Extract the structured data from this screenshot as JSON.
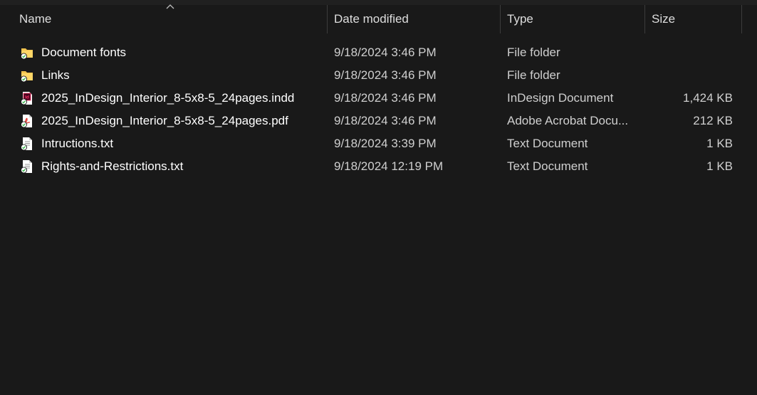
{
  "columns": {
    "name": "Name",
    "date": "Date modified",
    "type": "Type",
    "size": "Size"
  },
  "sort": {
    "column": "name",
    "direction": "ascending",
    "icon": "chevron-up-icon"
  },
  "files": [
    {
      "name": "Document fonts",
      "date": "9/18/2024 3:46 PM",
      "type": "File folder",
      "size": "",
      "icon": "folder-icon"
    },
    {
      "name": "Links",
      "date": "9/18/2024 3:46 PM",
      "type": "File folder",
      "size": "",
      "icon": "folder-icon"
    },
    {
      "name": "2025_InDesign_Interior_8-5x8-5_24pages.indd",
      "date": "9/18/2024 3:46 PM",
      "type": "InDesign Document",
      "size": "1,424 KB",
      "icon": "indesign-file-icon"
    },
    {
      "name": "2025_InDesign_Interior_8-5x8-5_24pages.pdf",
      "date": "9/18/2024 3:46 PM",
      "type": "Adobe Acrobat Docu...",
      "size": "212 KB",
      "icon": "pdf-file-icon"
    },
    {
      "name": "Intructions.txt",
      "date": "9/18/2024 3:39 PM",
      "type": "Text Document",
      "size": "1 KB",
      "icon": "text-file-icon"
    },
    {
      "name": "Rights-and-Restrictions.txt",
      "date": "9/18/2024 12:19 PM",
      "type": "Text Document",
      "size": "1 KB",
      "icon": "text-file-icon"
    }
  ],
  "colors": {
    "background": "#191919",
    "folder": "#f3c44f",
    "sync_badge": "#3fb950",
    "indesign": "#ff3366",
    "pdf": "#e0332b"
  }
}
